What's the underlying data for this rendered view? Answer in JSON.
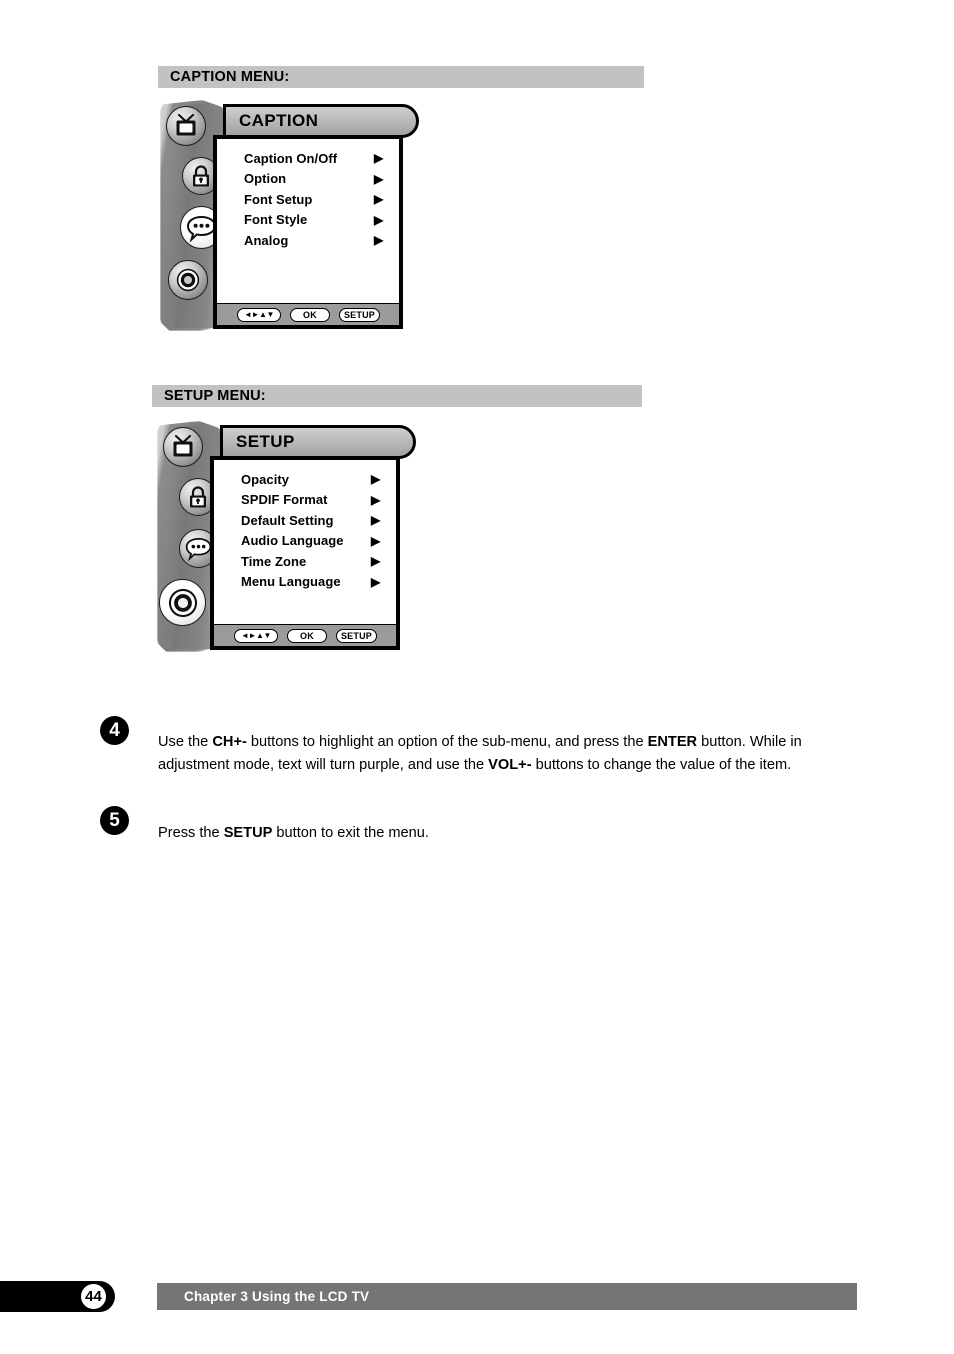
{
  "sections": {
    "caption": {
      "header_label": "CAPTION MENU:",
      "osd": {
        "title": "CAPTION",
        "items": [
          {
            "label": "Caption On/Off",
            "arrow": "▶"
          },
          {
            "label": "Option",
            "arrow": "▶"
          },
          {
            "label": "Font Setup",
            "arrow": "▶"
          },
          {
            "label": "Font Style",
            "arrow": "▶"
          },
          {
            "label": "Analog",
            "arrow": "▶"
          }
        ],
        "rail_icons": [
          {
            "name": "tv-icon",
            "state": "dim"
          },
          {
            "name": "lock-icon",
            "state": "dim"
          },
          {
            "name": "caption-bubble-icon",
            "state": "active"
          },
          {
            "name": "gear-icon",
            "state": "dim"
          }
        ],
        "footer": {
          "dpad": "◄►▲▼",
          "ok": "OK",
          "setup": "SETUP"
        }
      }
    },
    "setup": {
      "header_label": "SETUP MENU:",
      "osd": {
        "title": "SETUP",
        "items": [
          {
            "label": "Opacity",
            "arrow": "▶"
          },
          {
            "label": "SPDIF Format",
            "arrow": "▶"
          },
          {
            "label": "Default Setting",
            "arrow": "▶"
          },
          {
            "label": "Audio Language",
            "arrow": "▶"
          },
          {
            "label": "Time Zone",
            "arrow": "▶"
          },
          {
            "label": "Menu Language",
            "arrow": "▶"
          }
        ],
        "rail_icons": [
          {
            "name": "tv-icon",
            "state": "dim"
          },
          {
            "name": "lock-icon",
            "state": "dim"
          },
          {
            "name": "caption-bubble-icon",
            "state": "dim"
          },
          {
            "name": "gear-icon",
            "state": "active"
          }
        ],
        "footer": {
          "dpad": "◄►▲▼",
          "ok": "OK",
          "setup": "SETUP"
        }
      }
    }
  },
  "steps": [
    {
      "number": "4",
      "parts": [
        {
          "text": "Use the ",
          "bold": false
        },
        {
          "text": "CH+-",
          "bold": true
        },
        {
          "text": " buttons to highlight an option of the sub-menu, and press the ",
          "bold": false
        },
        {
          "text": "ENTER",
          "bold": true
        },
        {
          "text": " button. While in adjustment mode, text will turn purple, and use the ",
          "bold": false
        },
        {
          "text": "VOL+-",
          "bold": true
        },
        {
          "text": " buttons to change the value of the item.",
          "bold": false
        }
      ]
    },
    {
      "number": "5",
      "parts": [
        {
          "text": "Press the ",
          "bold": false
        },
        {
          "text": "SETUP",
          "bold": true
        },
        {
          "text": " button to exit the menu.",
          "bold": false
        }
      ]
    }
  ],
  "footer": {
    "page_number": "44",
    "chapter_label": "Chapter 3 Using the LCD TV"
  },
  "colors": {
    "section_header_bg": "#c2c2c2",
    "footer_bar_bg": "#757575",
    "osd_rail_gray": "#7d7d7d",
    "osd_title_gray": "#b9b9b9",
    "osd_foot_gray": "#9b9b9b"
  }
}
